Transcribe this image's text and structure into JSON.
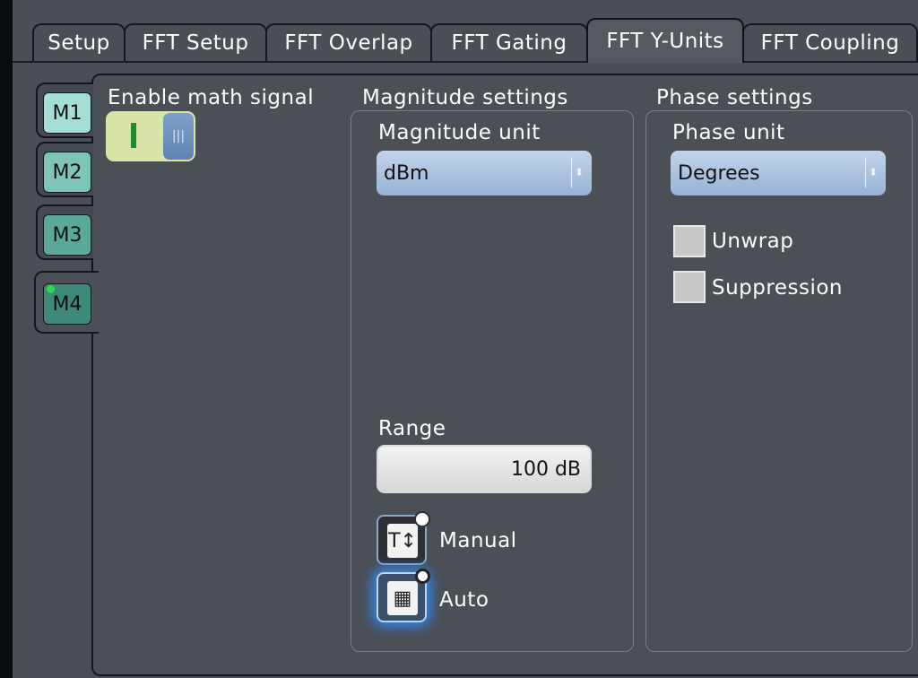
{
  "tabs": [
    {
      "label": "Setup"
    },
    {
      "label": "FFT Setup"
    },
    {
      "label": "FFT Overlap"
    },
    {
      "label": "FFT Gating"
    },
    {
      "label": "FFT Y-Units",
      "active": true
    },
    {
      "label": "FFT Coupling"
    }
  ],
  "math_tabs": [
    {
      "label": "M1",
      "color": "#a5ded6"
    },
    {
      "label": "M2",
      "color": "#7ec5b8"
    },
    {
      "label": "M3",
      "color": "#5aa898"
    },
    {
      "label": "M4",
      "color": "#3e8979",
      "active": true,
      "indicator": "#30d94a"
    }
  ],
  "enable": {
    "label": "Enable math signal",
    "state": "on"
  },
  "magnitude": {
    "group_title": "Magnitude settings",
    "unit_label": "Magnitude unit",
    "unit_value": "dBm",
    "range_label": "Range",
    "range_value": "100 dB",
    "mode_manual": "Manual",
    "mode_auto": "Auto",
    "selected_mode": "Auto"
  },
  "phase": {
    "group_title": "Phase settings",
    "unit_label": "Phase unit",
    "unit_value": "Degrees",
    "unwrap_label": "Unwrap",
    "unwrap_checked": false,
    "suppression_label": "Suppression",
    "suppression_checked": false
  },
  "colors": {
    "select_accent": "#97b2d6",
    "glow": "#2f8cff",
    "on_indicator": "#1e8c2e"
  }
}
